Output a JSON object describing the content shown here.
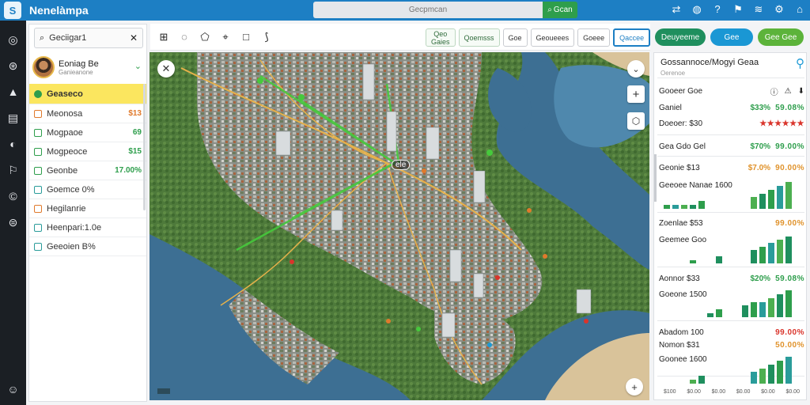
{
  "app": {
    "title": "Nenelàmpa",
    "logo": "S"
  },
  "search": {
    "placeholder": "Gecpmcan",
    "button_label": "Gcan"
  },
  "top_icons": [
    "share-icon",
    "globe-icon",
    "help-icon",
    "alert-icon",
    "wifi-icon",
    "settings-icon",
    "home-icon"
  ],
  "rail_icons": [
    "dashboard-icon",
    "map-icon",
    "layers-icon",
    "table-icon",
    "chart-icon",
    "flag-icon",
    "currency-icon",
    "lock-icon",
    "user-icon"
  ],
  "left_panel": {
    "search_value": "Geciigar1",
    "profile": {
      "name": "Eoniag Be",
      "subtitle": "Ganieanone"
    },
    "items": [
      {
        "label": "Geaseco",
        "value": "",
        "active": true,
        "icon_color": "green"
      },
      {
        "label": "Meonosa",
        "value": "$13",
        "icon_color": "orange"
      },
      {
        "label": "Mogpaoe",
        "value": "69",
        "icon_color": "green"
      },
      {
        "label": "Mogpeoce",
        "value": "$15",
        "icon_color": "green"
      },
      {
        "label": "Geonbe",
        "value": "17.00%",
        "icon_color": "green"
      },
      {
        "label": "Goemce 0%",
        "value": "",
        "icon_color": "teal"
      },
      {
        "label": "Hegilanrie",
        "value": "",
        "icon_color": "orange"
      },
      {
        "label": "Heenpari:1.0e",
        "value": "",
        "icon_color": "teal"
      },
      {
        "label": "Geeoien B%",
        "value": "",
        "icon_color": "teal"
      }
    ]
  },
  "map_toolbar": {
    "icons": [
      "grid-icon",
      "chat-icon",
      "shapes-icon",
      "tag-icon",
      "square-icon",
      "chart-tool-icon"
    ],
    "chips": [
      {
        "label": "Qeo Gaies",
        "style": "green"
      },
      {
        "label": "Qoemsss",
        "style": "green"
      },
      {
        "label": "Goe",
        "style": "plain"
      },
      {
        "label": "Geoueees",
        "style": "plain"
      },
      {
        "label": "Goeee",
        "style": "plain"
      },
      {
        "label": "Qaccee",
        "style": "blue"
      }
    ]
  },
  "actions": [
    {
      "label": "Deuyeeme",
      "color": "#1f8f5e",
      "width": 64
    },
    {
      "label": "Gee",
      "color": "#1a97d4",
      "width": 54
    },
    {
      "label": "Gee Gee",
      "color": "#5cb33a",
      "width": 58
    }
  ],
  "map": {
    "label_center": "ele",
    "route_color": "#46c93c",
    "road_color": "#e6b14a",
    "water_color": "#3d6f93"
  },
  "right_panel": {
    "title": "Gossannoce/Mogyi Geaa",
    "subtitle": "Oerenoe",
    "rows": [
      {
        "label": "Gooeer Goe",
        "v1": "",
        "v2": "",
        "icons": true
      },
      {
        "label": "Ganiel",
        "v1": "$33%",
        "v2": "59.08%",
        "v1c": "green",
        "v2c": "green"
      },
      {
        "label": "Doeoer: $30",
        "v1": "",
        "v2": "★★★★★★",
        "v2c": "red"
      },
      {
        "label": "Gea Gdo Gel",
        "v1": "$70%",
        "v2": "99.00%",
        "v1c": "green",
        "v2c": "green"
      },
      {
        "label": "Geonie $13",
        "v1": "$7.0%",
        "v2": "90.00%",
        "v1c": "orange",
        "v2c": "orange"
      },
      {
        "label": "Geeoee Nanae 1600",
        "v1": "",
        "v2": ""
      },
      {
        "label": "Zoenlae $53",
        "v1": "",
        "v2": "99.00%",
        "v2c": "orange"
      },
      {
        "label": "Geemee Goo",
        "v1": "",
        "v2": ""
      },
      {
        "label": "Aonnor $33",
        "v1": "$20%",
        "v2": "59.08%",
        "v1c": "green",
        "v2c": "green"
      },
      {
        "label": "Goeone 1500",
        "v1": "",
        "v2": ""
      },
      {
        "label": "Abadom 100",
        "v1": "",
        "v2": "99.00%",
        "v2c": "red"
      },
      {
        "label": "Nomon $31",
        "v1": "",
        "v2": "50.00%",
        "v2c": "orange"
      },
      {
        "label": "Goonee 1600",
        "v1": "",
        "v2": ""
      }
    ],
    "charts": [
      {
        "values": [
          1,
          1,
          1,
          1,
          2,
          0,
          0,
          0,
          0,
          0,
          3,
          4,
          5,
          6,
          7
        ]
      },
      {
        "values": [
          0,
          0,
          0,
          1,
          0,
          0,
          2,
          0,
          0,
          0,
          4,
          5,
          6,
          7,
          8
        ]
      },
      {
        "values": [
          0,
          0,
          0,
          0,
          0,
          1,
          2,
          0,
          0,
          3,
          4,
          4,
          5,
          6,
          7
        ]
      },
      {
        "values": [
          0,
          0,
          0,
          1,
          2,
          0,
          0,
          0,
          0,
          0,
          3,
          4,
          5,
          6,
          7
        ]
      }
    ],
    "axis": [
      "$100",
      "$0.00",
      "$0.00",
      "$0.00",
      "$0.00",
      "$0.00"
    ]
  }
}
